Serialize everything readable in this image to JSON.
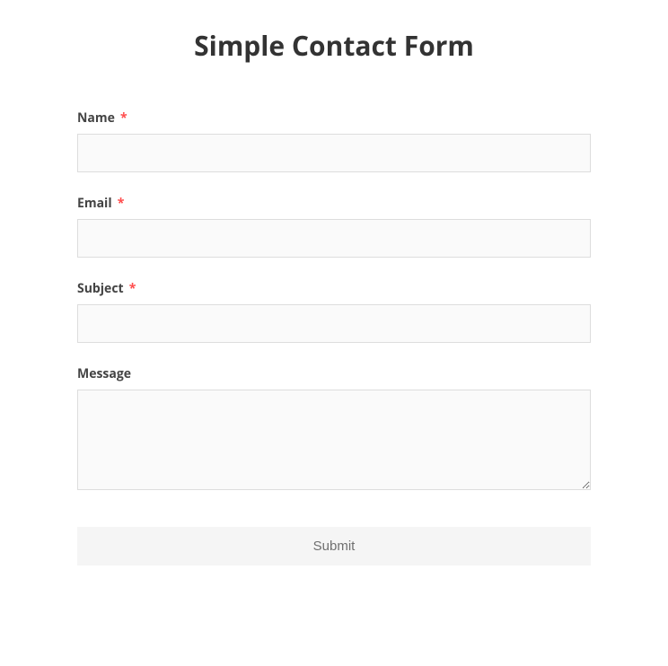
{
  "title": "Simple Contact Form",
  "required_marker": "*",
  "fields": {
    "name": {
      "label": "Name",
      "required": true,
      "value": ""
    },
    "email": {
      "label": "Email",
      "required": true,
      "value": ""
    },
    "subject": {
      "label": "Subject",
      "required": true,
      "value": ""
    },
    "message": {
      "label": "Message",
      "required": false,
      "value": ""
    }
  },
  "submit_label": "Submit"
}
